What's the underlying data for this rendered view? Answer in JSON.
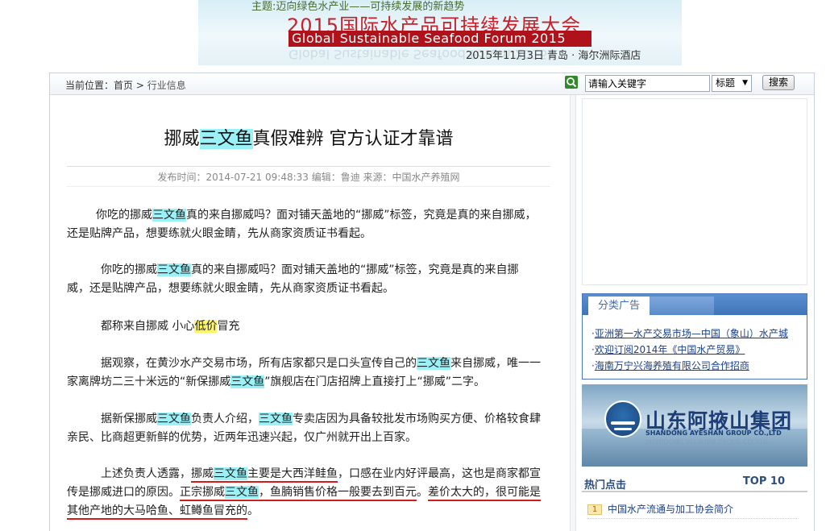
{
  "banner": {
    "theme": "主题:迈向绿色水产业——可持续发展的新趋势",
    "title_cn": "2015国际水产品可持续发展大会",
    "title_en": "Global Sustainable Seafood Forum 2015",
    "date_place": "2015年11月3日 青岛 · 海尔洲际酒店"
  },
  "breadcrumb": {
    "prefix": "当前位置：",
    "home": "首页",
    "sep": " > ",
    "current": "行业信息"
  },
  "search": {
    "placeholder": "请输入关键字",
    "field_select": "标题",
    "button": "搜索"
  },
  "article": {
    "title_pre": "挪威",
    "title_hl": "三文鱼",
    "title_post": "真假难辨 官方认证才靠谱",
    "meta": "发布时间：2014-07-21 09:48:33 编辑：鲁迪 来源：中国水产养殖网",
    "p1a": "你吃的挪威",
    "p1b": "三文鱼",
    "p1c": "真的来自挪威吗？面对铺天盖地的“挪威”标签，究竟是真的来自挪威，",
    "p1d": "还是贴牌产品，想要练就火眼金睛，先从商家资质证书看起。",
    "p2a": "你吃的挪威",
    "p2b": "三文鱼",
    "p2c": "真的来自挪威吗？面对铺天盖地的“挪威”标签，究竟是真的来自挪",
    "p2d": "威，还是贴牌产品，想要练就火眼金睛，先从商家资质证书看起。",
    "p3a": "都称来自挪威 小心",
    "p3b": "低价",
    "p3c": "冒充",
    "p4a": "据观察，在黄沙水产交易市场，所有店家都只是口头宣传自己的",
    "p4b": "三文鱼",
    "p4c": "来自挪威，唯一一",
    "p4d": "家离牌坊二三十米远的“新保挪威",
    "p4e": "三文鱼",
    "p4f": "”旗舰店在门店招牌上直接打上“挪威”二字。",
    "p5a": "据新保挪威",
    "p5b": "三文鱼",
    "p5c": "负责人介绍，",
    "p5d": "三文鱼",
    "p5e": "专卖店因为具备较批发市场购买方便、价格较食肆",
    "p5f": "亲民、比商超更新鲜的优势，近两年迅速兴起，仅广州就开出上百家。",
    "p6a": "上述负责人透露，",
    "p6b": "挪威",
    "p6c": "三文鱼",
    "p6d": "主要是大西洋鲑鱼",
    "p6e": "，口感在业内好评最高，这也是商家都宣",
    "p6f": "传是挪威进口的原因。",
    "p6g": "正宗挪威",
    "p6h": "三文鱼",
    "p6i": "，鱼腩销售价格一般要去到百元",
    "p6j": "。",
    "p6k": "差价太大的，很可能是",
    "p6l": "其他产地的大马哈鱼、虹鳟鱼冒充的",
    "p6m": "。"
  },
  "sidebar": {
    "ad_tab": "分类广告",
    "ad_links": [
      {
        "bullet": "·",
        "text": "亚洲第一水产交易市场—中国（象山）水产城"
      },
      {
        "bullet": "·",
        "text": "欢迎订阅2014年《中国水产贸易》"
      },
      {
        "bullet": "·",
        "text": "海南万宁兴海养殖有限公司合作招商"
      }
    ],
    "logo_cn": "山东阿掖山集团",
    "logo_en": "SHANDONG AYESHAN GROUP CO.,LTD",
    "hot_title": "热门点击",
    "hot_top": "TOP 10",
    "hot_items": [
      {
        "num": "1",
        "text": "中国水产流通与加工协会简介"
      }
    ]
  }
}
